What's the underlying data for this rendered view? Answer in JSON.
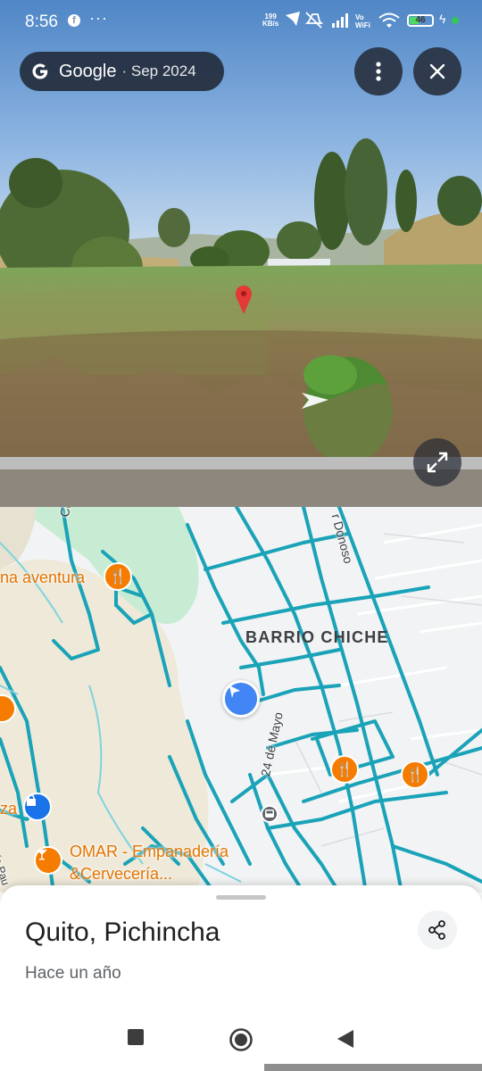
{
  "status_bar": {
    "time": "8:56",
    "overflow": "···",
    "speed": "199",
    "speed_unit": "KB/s",
    "vowifi_top": "Vo",
    "vowifi_bottom": "WiFi",
    "battery": "46",
    "battery_level": 0.46
  },
  "streetview": {
    "brand": "Google",
    "date": "· Sep 2024",
    "icons": [
      "google-g-icon",
      "more-vert-icon",
      "close-icon",
      "fullscreen-icon",
      "navigation-arrow-icon",
      "location-pin-icon"
    ]
  },
  "map": {
    "pois": [
      {
        "label": "na aventura",
        "icon": "restaurant-icon"
      },
      {
        "label": "OMAR - Empanadería",
        "label2": "&Cervecería...",
        "icon": "bar-icon"
      }
    ],
    "area_label": "BARRIO CHICHE",
    "streets": [
      "Chiche",
      "r Donoso",
      "24 de Mayo",
      "Río Pau"
    ],
    "partial_label": "za",
    "colors": {
      "roads": "#1aa3b8",
      "poi": "#e37400",
      "location": "#4285f4",
      "park": "#c8ecd3",
      "terrain": "#efe9d9"
    }
  },
  "sheet": {
    "title": "Quito, Pichincha",
    "subtitle": "Hace un año",
    "share_icon": "share-icon"
  },
  "nav": {
    "icons": [
      "recents-square-icon",
      "home-circle-icon",
      "back-triangle-icon"
    ]
  }
}
